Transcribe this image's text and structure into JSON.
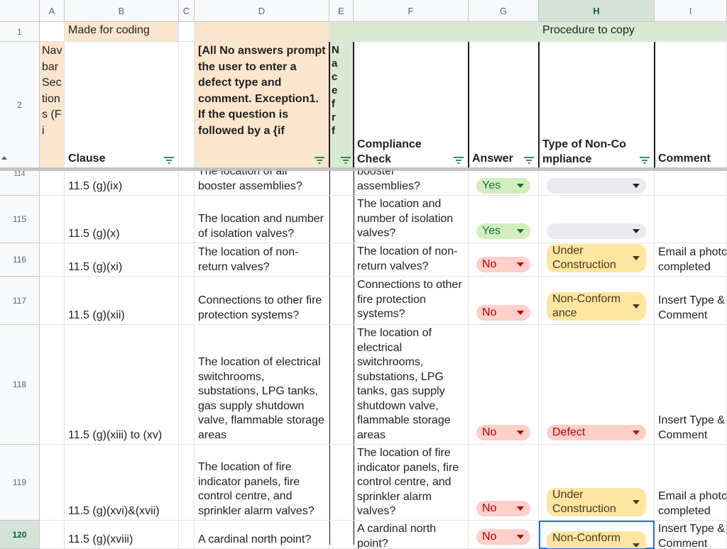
{
  "columns": [
    "A",
    "B",
    "C",
    "D",
    "E",
    "F",
    "G",
    "H",
    "I"
  ],
  "row1": {
    "num": "1",
    "made_for_coding": "Made for coding",
    "procedure_to_copy": "Procedure to copy"
  },
  "header_row": {
    "num": "2",
    "a": "Navbar Sections (Fi",
    "b": "Clause",
    "d": "[All No answers prompt the user to enter a defect type and comment. Exception1. If the question is followed by a {if",
    "e": "N a c e f r f",
    "f": "Compliance Check",
    "g": "Answer",
    "h": "Type of Non-Compliance",
    "i": "Comment"
  },
  "partial_top": {
    "num": "114",
    "b": "11.5 (g)(ix)",
    "d_top": "The location of all",
    "d": "booster assemblies?",
    "f_top": "booster",
    "f": "assemblies?",
    "answer": "Yes"
  },
  "rows": [
    {
      "num": "115",
      "clause": "11.5 (g)(x)",
      "question": "The location and number of isolation valves?",
      "check": "The location and number of isolation valves?",
      "answer": "Yes",
      "type": "",
      "comment": ""
    },
    {
      "num": "116",
      "clause": "11.5 (g)(xi)",
      "question": "The location of non-return valves?",
      "check": "The location of non-return valves?",
      "answer": "No",
      "type": "Under Construction",
      "comment": "Email a photo completed"
    },
    {
      "num": "117",
      "clause": "11.5 (g)(xii)",
      "question": "Connections to other fire protection systems?",
      "check": "Connections to other fire protection systems?",
      "answer": "No",
      "type": "Non-Conform ance",
      "comment": "Insert Type & Comment"
    },
    {
      "num": "118",
      "clause": "11.5 (g)(xiii) to (xv)",
      "question": "The location of electrical switchrooms, substations, LPG tanks, gas supply shutdown valve, flammable storage areas",
      "check": "The location of electrical switchrooms, substations, LPG tanks, gas supply shutdown valve, flammable storage areas",
      "answer": "No",
      "type": "Defect",
      "comment": "Insert Type & Comment"
    },
    {
      "num": "119",
      "clause": "11.5 (g)(xvi)&(xvii)",
      "question": "The location of fire indicator panels, fire control centre, and sprinkler alarm valves?",
      "check": "The location of fire indicator panels, fire control centre, and sprinkler alarm valves?",
      "answer": "No",
      "type": "Under Construction",
      "comment": "Email a photo completed"
    },
    {
      "num": "120",
      "clause": "11.5 (g)(xviii)",
      "question": "A cardinal north point?",
      "check": "A cardinal north point?",
      "answer": "No",
      "type": "Non-Conform ance",
      "comment": "Insert Type & Comment"
    }
  ],
  "colors": {
    "peach": "#fce5cd",
    "green": "#d9ead3",
    "selected": "#d3e3d8",
    "yes": "#d4edbc",
    "no": "#ffcfc9",
    "warn": "#ffe5a0"
  }
}
